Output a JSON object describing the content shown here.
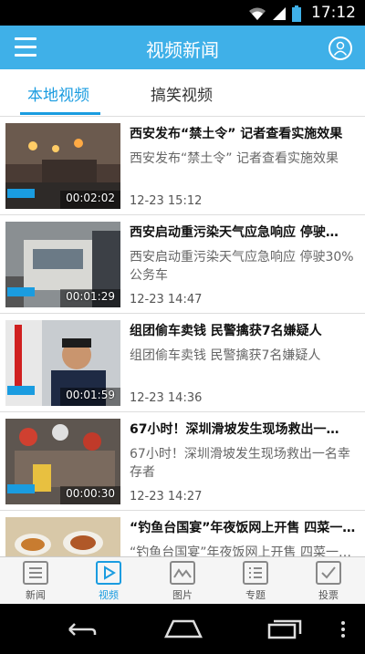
{
  "status": {
    "time": "17:12"
  },
  "app_bar": {
    "title": "视频新闻"
  },
  "tabs": [
    {
      "label": "本地视频",
      "active": true
    },
    {
      "label": "搞笑视频",
      "active": false
    }
  ],
  "items": [
    {
      "headline": "西安发布“禁土令” 记者查看实施效果",
      "summary": "西安发布“禁土令” 记者查看实施效果",
      "date": "12-23 15:12",
      "duration": "00:02:02"
    },
    {
      "headline": "西安启动重污染天气应急响应 停驶…",
      "summary": "西安启动重污染天气应急响应 停驶30%公务车",
      "date": "12-23 14:47",
      "duration": "00:01:29"
    },
    {
      "headline": "组团偷车卖钱 民警擒获7名嫌疑人",
      "summary": "组团偷车卖钱 民警擒获7名嫌疑人",
      "date": "12-23 14:36",
      "duration": "00:01:59"
    },
    {
      "headline": "67小时！深圳滑坡发生现场救出一…",
      "summary": "67小时！深圳滑坡发生现场救出一名幸存者",
      "date": "12-23 14:27",
      "duration": "00:00:30"
    },
    {
      "headline": "“钓鱼台国宴”年夜饭网上开售 四菜一…",
      "summary": "“钓鱼台国宴”年夜饭网上开售 四菜一…",
      "date": "",
      "duration": ""
    }
  ],
  "bottom_nav": [
    {
      "label": "新闻",
      "icon": "news-icon",
      "active": false
    },
    {
      "label": "视频",
      "icon": "video-icon",
      "active": true
    },
    {
      "label": "图片",
      "icon": "picture-icon",
      "active": false
    },
    {
      "label": "专题",
      "icon": "topic-icon",
      "active": false
    },
    {
      "label": "投票",
      "icon": "vote-icon",
      "active": false
    }
  ],
  "colors": {
    "accent": "#3fb0e8",
    "active_tab": "#1a9ce0"
  }
}
